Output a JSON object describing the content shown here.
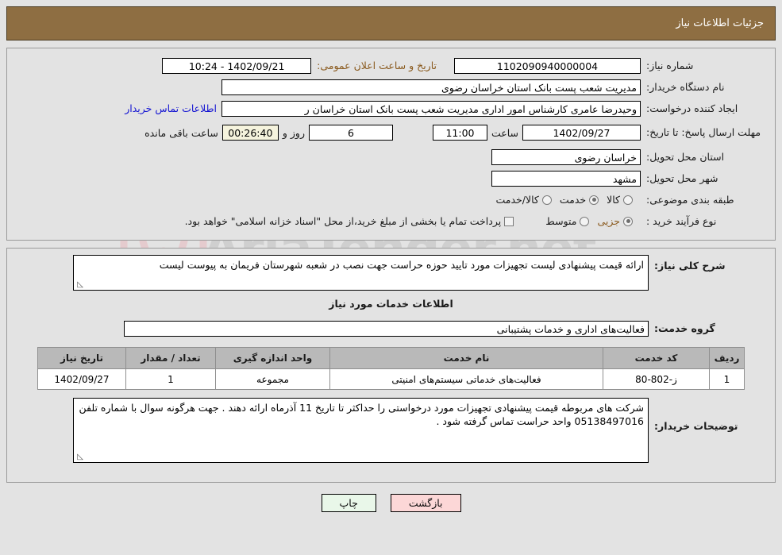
{
  "header": {
    "title": "جزئیات اطلاعات نیاز"
  },
  "form": {
    "need_number_label": "شماره نیاز:",
    "need_number_value": "1102090940000004",
    "announce_label": "تاریخ و ساعت اعلان عمومی:",
    "announce_value": "1402/09/21 - 10:24",
    "buyer_org_label": "نام دستگاه خریدار:",
    "buyer_org_value": "مدیریت شعب پست بانک استان خراسان رضوی",
    "creator_label": "ایجاد کننده درخواست:",
    "creator_value": "وحیدرضا عامری کارشناس امور اداری مدیریت شعب پست بانک استان خراسان ر",
    "creator_link": "اطلاعات تماس خریدار",
    "deadline_label": "مهلت ارسال پاسخ: تا تاریخ:",
    "deadline_date": "1402/09/27",
    "deadline_hour_label": "ساعت",
    "deadline_hour": "11:00",
    "days_value": "6",
    "days_label": "روز و",
    "countdown_value": "00:26:40",
    "countdown_label": "ساعت باقی مانده",
    "province_label": "استان محل تحویل:",
    "province_value": "خراسان رضوی",
    "city_label": "شهر محل تحویل:",
    "city_value": "مشهد",
    "category_label": "طبقه بندی موضوعی:",
    "category_options": [
      {
        "label": "کالا",
        "selected": false
      },
      {
        "label": "خدمت",
        "selected": true
      },
      {
        "label": "کالا/خدمت",
        "selected": false
      }
    ],
    "purchase_label": "نوع فرآیند خرید :",
    "purchase_options": [
      {
        "label": "جزیی",
        "selected": true
      },
      {
        "label": "متوسط",
        "selected": false
      }
    ],
    "treasury_checkbox_checked": false,
    "treasury_text": "پرداخت تمام یا بخشی از مبلغ خرید،از محل \"اسناد خزانه اسلامی\" خواهد بود."
  },
  "description": {
    "label": "شرح کلی نیاز:",
    "value": "ارائه قیمت پیشنهادی لیست تجهیزات مورد تایید حوزه حراست جهت نصب در شعبه شهرستان فریمان به پیوست لیست"
  },
  "services_section": {
    "title": "اطلاعات خدمات مورد نیاز",
    "group_label": "گروه خدمت:",
    "group_value": "فعالیت‌های اداری و خدمات پشتیبانی"
  },
  "table": {
    "columns": [
      "ردیف",
      "کد خدمت",
      "نام خدمت",
      "واحد اندازه گیری",
      "تعداد / مقدار",
      "تاریخ نیاز"
    ],
    "rows": [
      {
        "row_no": "1",
        "service_code": "ز-802-80",
        "service_name": "فعالیت‌های خدماتی سیستم‌های امنیتی",
        "unit": "مجموعه",
        "quantity": "1",
        "need_date": "1402/09/27"
      }
    ]
  },
  "buyer_notes": {
    "label": "توضیحات خریدار:",
    "value": "شرکت های مربوطه قیمت پیشنهادی تجهیزات مورد درخواستی را حداکثر تا تاریخ 11 آذرماه ارائه دهند . جهت هرگونه سوال با شماره تلفن 05138497016 واحد حراست  تماس گرفته شود ."
  },
  "footer": {
    "print_label": "چاپ",
    "back_label": "بازگشت"
  },
  "watermark": {
    "text": "AriaTender.net"
  },
  "colors": {
    "header_bar": "#8e6e42",
    "page_bg": "#e3e3e3",
    "link": "#1414d2",
    "accent_brown": "#8a5a1e",
    "print_btn": "#e9f7e9",
    "back_btn": "#fcd7d7",
    "table_header": "#b9b9b9"
  }
}
